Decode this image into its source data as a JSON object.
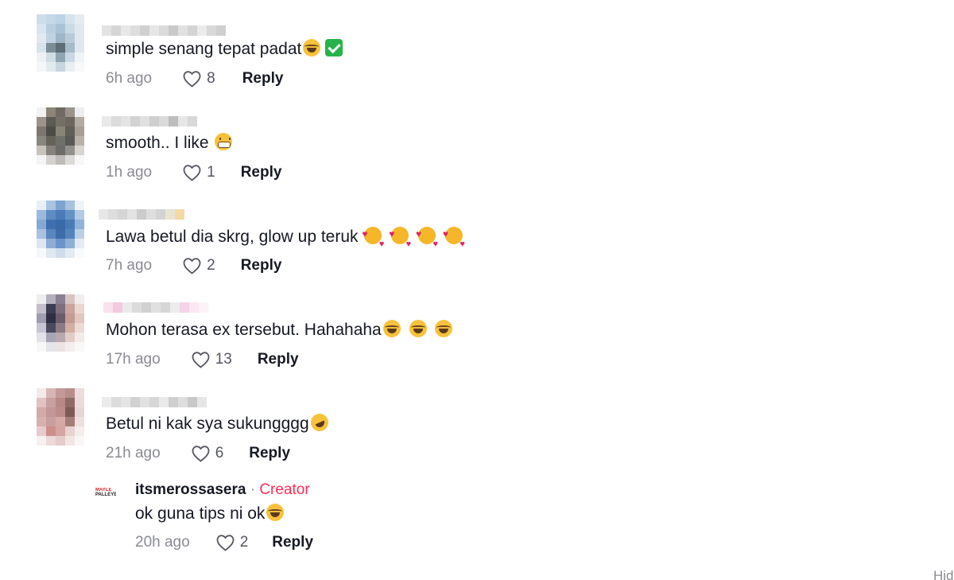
{
  "comments": [
    {
      "text": "simple senang tepat padat",
      "emoji": [
        "laugh",
        "check"
      ],
      "time": "6h ago",
      "likes": "8",
      "reply_label": "Reply",
      "avatar_colors": [
        "#cfdde8",
        "#c5d8e8",
        "#bcd3e6",
        "#d6e2ec",
        "#e4ecf1",
        "#d8e4ee",
        "#b9cfe0",
        "#a9c3d6",
        "#c9dae7",
        "#dfe8ef",
        "#e1e9ef",
        "#c0d3e2",
        "#9fb6c6",
        "#b8cad8",
        "#e0e8ee",
        "#d7e3eb",
        "#7b8e97",
        "#5d6e78",
        "#a7bcc9",
        "#dfe7ee",
        "#edf1f4",
        "#d0dde6",
        "#8fa5b2",
        "#c9d8e2",
        "#f0f3f5",
        "#f4f6f8",
        "#e3eaef",
        "#c7d5df",
        "#e8eef2",
        "#f7f8f9"
      ],
      "username_colors": [
        "#e3e3e3",
        "#d6d6d6",
        "#e8e8e8",
        "#dedede",
        "#d0d0d0",
        "#e6e6e6",
        "#dadada",
        "#c9c9c9",
        "#e1e1e1",
        "#d4d4d4",
        "#ebebeb",
        "#d8d8d8",
        "#cfcfcf"
      ]
    },
    {
      "text": "smooth.. I like ",
      "emoji": [
        "grin"
      ],
      "time": "1h ago",
      "likes": "1",
      "reply_label": "Reply",
      "avatar_colors": [
        "#f2f2f2",
        "#8d8579",
        "#6f6a62",
        "#9a948b",
        "#ededed",
        "#9c9488",
        "#5d5a54",
        "#747068",
        "#6b665e",
        "#b3aca2",
        "#7c776f",
        "#4f4c47",
        "#898479",
        "#615d57",
        "#a6a096",
        "#8a8680",
        "#65625c",
        "#70706a",
        "#5b5955",
        "#b8b2a8",
        "#c7c2ba",
        "#86827c",
        "#6d6b67",
        "#92908b",
        "#d9d6d1",
        "#f4f4f4",
        "#d3d1ce",
        "#bebcb8",
        "#dcdad7",
        "#f7f7f7"
      ],
      "username_colors": [
        "#e9e9e9",
        "#dcdcdc",
        "#e4e4e4",
        "#d2d2d2",
        "#e0e0e0",
        "#cfcfcf",
        "#dadada",
        "#bdbdbd",
        "#e6e6e6",
        "#d8d8d8"
      ]
    },
    {
      "text": "Lawa betul dia skrg, glow up teruk ",
      "emoji": [
        "love",
        "love",
        "love",
        "love"
      ],
      "time": "7h ago",
      "likes": "2",
      "reply_label": "Reply",
      "avatar_colors": [
        "#e9eff6",
        "#a9c3e0",
        "#7da3cf",
        "#a7c1df",
        "#eef3f8",
        "#9bb9dc",
        "#5f8cc2",
        "#4a7bb8",
        "#6592c6",
        "#b3cae4",
        "#86a9d2",
        "#3f6fae",
        "#3a6aa8",
        "#4b7bb7",
        "#92b2d8",
        "#a8c2e0",
        "#5a86bf",
        "#3e6ca9",
        "#5583bd",
        "#b9cfe6",
        "#dde7f1",
        "#8eadd4",
        "#6b95c8",
        "#90afd5",
        "#e2eaf3",
        "#f6f8fb",
        "#dfe7f1",
        "#cfdcec",
        "#e3eaf3",
        "#f8fafc"
      ],
      "username_colors": [
        "#e7e7e7",
        "#dddddd",
        "#d5d5d5",
        "#e2e2e2",
        "#cbcbcb",
        "#dedede",
        "#d3d3d3",
        "#e9e3d2",
        "#f3d9a6"
      ]
    },
    {
      "text": "Mohon terasa ex tersebut. Hahahaha",
      "emoji": [
        "laugh",
        "laugh",
        "laugh"
      ],
      "time": "17h ago",
      "likes": "13",
      "reply_label": "Reply",
      "avatar_colors": [
        "#eeeeee",
        "#b4aebd",
        "#8a7f93",
        "#d9c3c0",
        "#f1eded",
        "#c3c0cc",
        "#3c3c52",
        "#7e6f7e",
        "#caa59c",
        "#ead7d2",
        "#9f9bb0",
        "#2e2f45",
        "#6a5d6b",
        "#c49d92",
        "#e1c7bf",
        "#c8c5d2",
        "#4a4a60",
        "#8a7b86",
        "#d3aea3",
        "#ecdad4",
        "#e3e2e8",
        "#a7a5b4",
        "#b7a9ae",
        "#e2cdc6",
        "#f3ebe8",
        "#f7f7f8",
        "#e5e4ea",
        "#ece3e2",
        "#f4eeec",
        "#faf8f7"
      ],
      "username_colors": [
        "#f9e1ee",
        "#f3c9df",
        "#eaeaea",
        "#dcdcdc",
        "#d1d1d1",
        "#e0e0e0",
        "#d6d6d6",
        "#ececec",
        "#f4d3e4",
        "#fbe7f1",
        "#fdf2f8"
      ]
    },
    {
      "text": "Betul ni kak sya sukungggg",
      "emoji": [
        "rofl"
      ],
      "time": "21h ago",
      "likes": "6",
      "reply_label": "Reply",
      "avatar_colors": [
        "#f3eaea",
        "#d8b5b4",
        "#c4999a",
        "#b98d8b",
        "#ecdcdc",
        "#e0c3c2",
        "#c9a09f",
        "#b78886",
        "#8f6a66",
        "#eadada",
        "#d2aaa8",
        "#c49695",
        "#bd8c8a",
        "#7d5a55",
        "#e6d5d5",
        "#d7b1ae",
        "#c89f9c",
        "#d6a9a6",
        "#a47d79",
        "#eee0df",
        "#e8cccb",
        "#cc8f8c",
        "#d7a4a1",
        "#e9d2d1",
        "#f5ecec",
        "#f7f0f0",
        "#ecd9d8",
        "#e4cbca",
        "#f2e6e5",
        "#faf6f6"
      ],
      "username_colors": [
        "#ebebeb",
        "#dcdcdc",
        "#e4e4e4",
        "#d1d1d1",
        "#e1e1e1",
        "#d6d6d6",
        "#e9e9e9",
        "#cfcfcf",
        "#dedede",
        "#c8c8c8",
        "#e6e6e6"
      ]
    }
  ],
  "reply": {
    "logo_text_top": "MAYLE",
    "logo_text_bottom": "PALLEYBEAM",
    "username": "itsmerossasera",
    "separator": " · ",
    "badge": "Creator",
    "text": "ok guna tips ni ok",
    "emoji": [
      "laugh"
    ],
    "time": "20h ago",
    "likes": "2",
    "reply_label": "Reply"
  },
  "corner_text": "Hid",
  "colors": {
    "creator": "#fe2c55",
    "time": "#8a8b91",
    "text": "#161823"
  },
  "icons": {
    "like": "heart-outline-icon"
  }
}
